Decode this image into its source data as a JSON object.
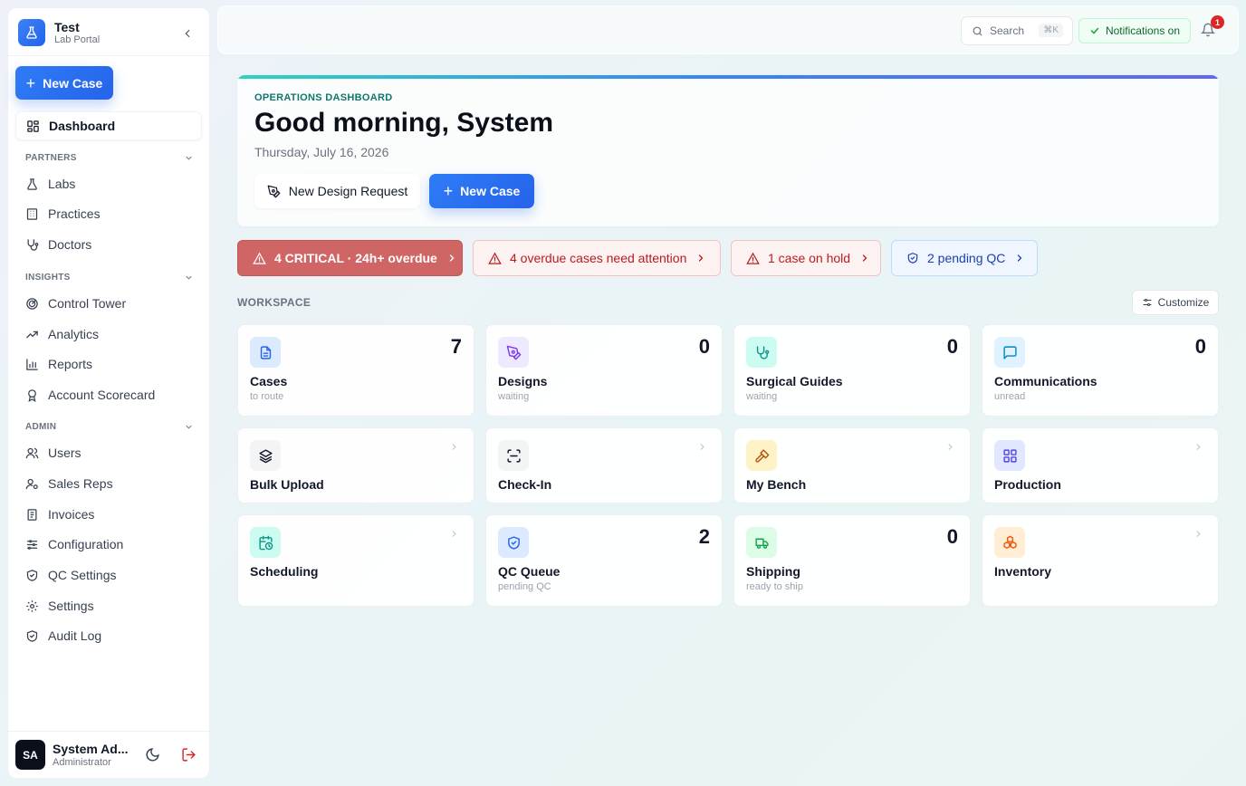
{
  "brand": {
    "title": "Test",
    "subtitle": "Lab Portal"
  },
  "sidebar": {
    "new_case": "New Case",
    "dashboard": "Dashboard",
    "sections": {
      "partners": "PARTNERS",
      "insights": "INSIGHTS",
      "admin": "ADMIN"
    },
    "partners": [
      "Labs",
      "Practices",
      "Doctors"
    ],
    "insights": [
      "Control Tower",
      "Analytics",
      "Reports",
      "Account Scorecard"
    ],
    "admin": [
      "Users",
      "Sales Reps",
      "Invoices",
      "Configuration",
      "QC Settings",
      "Settings",
      "Audit Log"
    ]
  },
  "user": {
    "initials": "SA",
    "name": "System Ad...",
    "role": "Administrator"
  },
  "header": {
    "search_label": "Search",
    "search_shortcut": "⌘K",
    "notifications": "Notifications on",
    "bell_count": "1"
  },
  "hero": {
    "eyebrow": "OPERATIONS DASHBOARD",
    "title": "Good morning, System",
    "date": "Thursday, July 16, 2026",
    "design_button": "New Design Request",
    "new_case_button": "New Case"
  },
  "alerts": {
    "critical": "4 CRITICAL · 24h+ overdue",
    "overdue": "4 overdue cases need attention",
    "hold": "1 case on hold",
    "qc": "2 pending QC"
  },
  "workspace": {
    "label": "WORKSPACE",
    "customize": "Customize",
    "tiles": [
      {
        "title": "Cases",
        "sub": "to route",
        "count": "7"
      },
      {
        "title": "Designs",
        "sub": "waiting",
        "count": "0"
      },
      {
        "title": "Surgical Guides",
        "sub": "waiting",
        "count": "0"
      },
      {
        "title": "Communications",
        "sub": "unread",
        "count": "0"
      },
      {
        "title": "Bulk Upload"
      },
      {
        "title": "Check-In"
      },
      {
        "title": "My Bench"
      },
      {
        "title": "Production"
      },
      {
        "title": "Scheduling"
      },
      {
        "title": "QC Queue",
        "sub": "pending QC",
        "count": "2"
      },
      {
        "title": "Shipping",
        "sub": "ready to ship",
        "count": "0"
      },
      {
        "title": "Inventory"
      }
    ]
  },
  "colors": {
    "accent": "#2563eb",
    "critical": "#d06565",
    "success": "#166534"
  }
}
